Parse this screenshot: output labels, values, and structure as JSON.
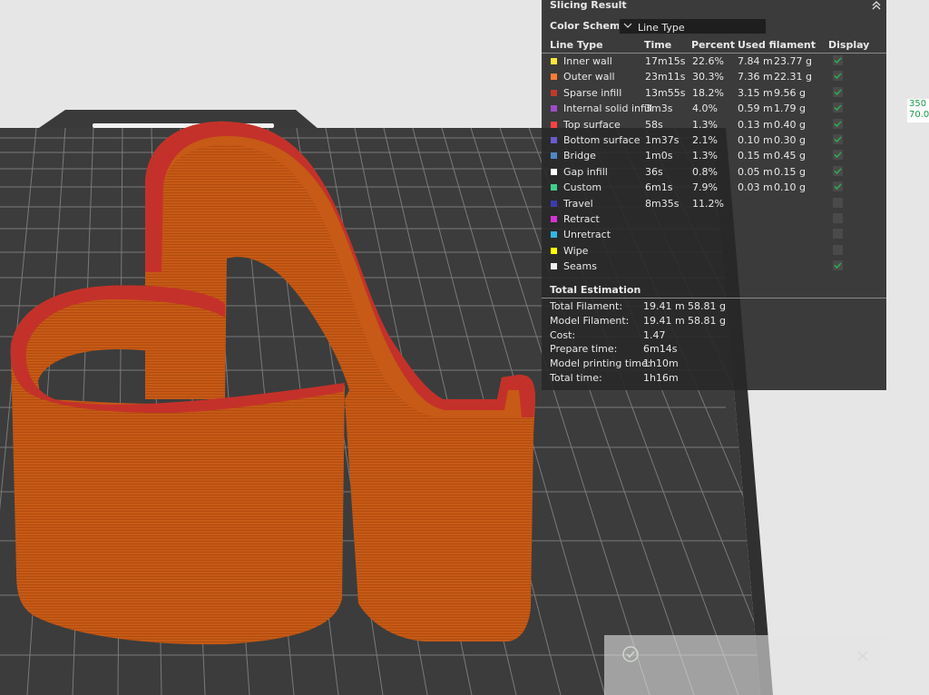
{
  "panel": {
    "title": "Slicing Result",
    "color_scheme_label": "Color Scheme",
    "color_scheme_value": "Line Type",
    "columns": [
      "Line Type",
      "Time",
      "Percent",
      "Used filament",
      "Display"
    ],
    "rows": [
      {
        "name": "Inner wall",
        "color": "#ffe63c",
        "time": "17m15s",
        "percent": "22.6%",
        "length": "7.84 m",
        "weight": "23.77 g",
        "display": true
      },
      {
        "name": "Outer wall",
        "color": "#ff7c33",
        "time": "23m11s",
        "percent": "30.3%",
        "length": "7.36 m",
        "weight": "22.31 g",
        "display": true
      },
      {
        "name": "Sparse infill",
        "color": "#c0392b",
        "time": "13m55s",
        "percent": "18.2%",
        "length": "3.15 m",
        "weight": "9.56 g",
        "display": true
      },
      {
        "name": "Internal solid infill",
        "color": "#a04cc9",
        "time": "3m3s",
        "percent": "4.0%",
        "length": "0.59 m",
        "weight": "1.79 g",
        "display": true
      },
      {
        "name": "Top surface",
        "color": "#ff4040",
        "time": "58s",
        "percent": "1.3%",
        "length": "0.13 m",
        "weight": "0.40 g",
        "display": true
      },
      {
        "name": "Bottom surface",
        "color": "#6a5acd",
        "time": "1m37s",
        "percent": "2.1%",
        "length": "0.10 m",
        "weight": "0.30 g",
        "display": true
      },
      {
        "name": "Bridge",
        "color": "#4f86c6",
        "time": "1m0s",
        "percent": "1.3%",
        "length": "0.15 m",
        "weight": "0.45 g",
        "display": true
      },
      {
        "name": "Gap infill",
        "color": "#ffffff",
        "time": "36s",
        "percent": "0.8%",
        "length": "0.05 m",
        "weight": "0.15 g",
        "display": true
      },
      {
        "name": "Custom",
        "color": "#3ecf8e",
        "time": "6m1s",
        "percent": "7.9%",
        "length": "0.03 m",
        "weight": "0.10 g",
        "display": true
      },
      {
        "name": "Travel",
        "color": "#3b3bb0",
        "time": "8m35s",
        "percent": "11.2%",
        "length": "",
        "weight": "",
        "display": false
      },
      {
        "name": "Retract",
        "color": "#d633d6",
        "time": "",
        "percent": "",
        "length": "",
        "weight": "",
        "display": false
      },
      {
        "name": "Unretract",
        "color": "#33b5e5",
        "time": "",
        "percent": "",
        "length": "",
        "weight": "",
        "display": false
      },
      {
        "name": "Wipe",
        "color": "#ffff00",
        "time": "",
        "percent": "",
        "length": "",
        "weight": "",
        "display": false
      },
      {
        "name": "Seams",
        "color": "#f0f0f0",
        "time": "",
        "percent": "",
        "length": "",
        "weight": "",
        "display": true
      }
    ],
    "estimation_title": "Total Estimation",
    "estimation": [
      {
        "label": "Total Filament:",
        "v1": "19.41 m",
        "v2": "58.81 g"
      },
      {
        "label": "Model Filament:",
        "v1": "19.41 m",
        "v2": "58.81 g"
      },
      {
        "label": "Cost:",
        "v1": "1.47",
        "v2": ""
      },
      {
        "label": "Prepare time:",
        "v1": "6m14s",
        "v2": ""
      },
      {
        "label": "Model printing time:",
        "v1": "1h10m",
        "v2": ""
      },
      {
        "label": "Total time:",
        "v1": "1h16m",
        "v2": ""
      }
    ]
  },
  "coords": {
    "line1": "350",
    "line2": "70.0"
  },
  "colors": {
    "accent_green": "#2fa84f",
    "plate": "#3c3c3c",
    "model_wall": "#c75a14",
    "model_top": "#c4312a"
  }
}
